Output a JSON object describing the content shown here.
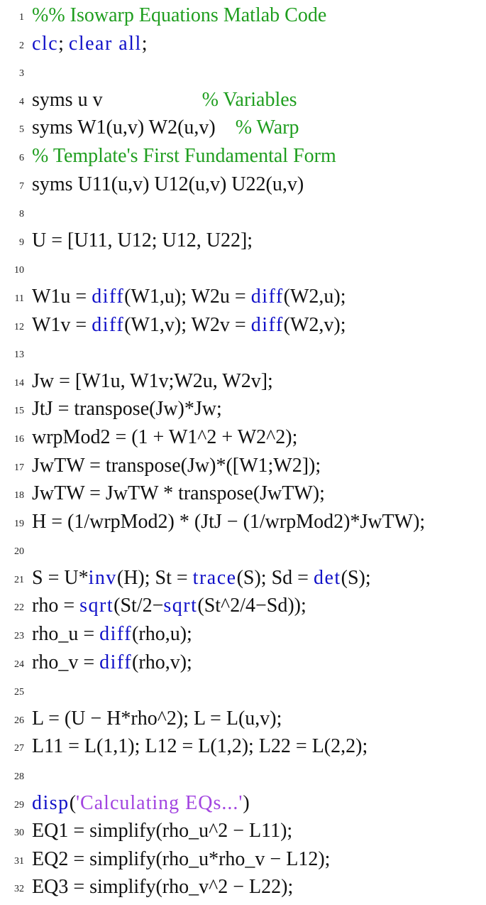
{
  "document": {
    "title": "Isowarp Equations Matlab Code",
    "language": "Matlab",
    "colors": {
      "text": "#111111",
      "keyword": "#1010c8",
      "comment": "#1f9e1f",
      "string": "#a244e0"
    },
    "lines": [
      {
        "n": "1",
        "tokens": [
          {
            "t": "cm",
            "v": "%% Isowarp Equations Matlab Code"
          }
        ]
      },
      {
        "n": "2",
        "tokens": [
          {
            "t": "kw",
            "v": "clc"
          },
          {
            "t": "nm",
            "v": "; "
          },
          {
            "t": "kw",
            "v": "clear all"
          },
          {
            "t": "nm",
            "v": ";"
          }
        ]
      },
      {
        "n": "3",
        "tokens": []
      },
      {
        "n": "4",
        "tokens": [
          {
            "t": "nm",
            "v": "syms u v                    "
          },
          {
            "t": "cm",
            "v": "% Variables"
          }
        ]
      },
      {
        "n": "5",
        "tokens": [
          {
            "t": "nm",
            "v": "syms W1(u,v) W2(u,v)    "
          },
          {
            "t": "cm",
            "v": "% Warp"
          }
        ]
      },
      {
        "n": "6",
        "tokens": [
          {
            "t": "cm",
            "v": "% Template's First Fundamental Form"
          }
        ]
      },
      {
        "n": "7",
        "tokens": [
          {
            "t": "nm",
            "v": "syms U11(u,v) U12(u,v) U22(u,v)"
          }
        ]
      },
      {
        "n": "8",
        "tokens": []
      },
      {
        "n": "9",
        "tokens": [
          {
            "t": "nm",
            "v": "U = [U11, U12; U12, U22];"
          }
        ]
      },
      {
        "n": "10",
        "tokens": []
      },
      {
        "n": "11",
        "tokens": [
          {
            "t": "nm",
            "v": "W1u = "
          },
          {
            "t": "kw",
            "v": "diff"
          },
          {
            "t": "nm",
            "v": "(W1,u); W2u = "
          },
          {
            "t": "kw",
            "v": "diff"
          },
          {
            "t": "nm",
            "v": "(W2,u);"
          }
        ]
      },
      {
        "n": "12",
        "tokens": [
          {
            "t": "nm",
            "v": "W1v = "
          },
          {
            "t": "kw",
            "v": "diff"
          },
          {
            "t": "nm",
            "v": "(W1,v); W2v = "
          },
          {
            "t": "kw",
            "v": "diff"
          },
          {
            "t": "nm",
            "v": "(W2,v);"
          }
        ]
      },
      {
        "n": "13",
        "tokens": []
      },
      {
        "n": "14",
        "tokens": [
          {
            "t": "nm",
            "v": "Jw = [W1u, W1v;W2u, W2v];"
          }
        ]
      },
      {
        "n": "15",
        "tokens": [
          {
            "t": "nm",
            "v": "JtJ = transpose(Jw)*Jw;"
          }
        ]
      },
      {
        "n": "16",
        "tokens": [
          {
            "t": "nm",
            "v": "wrpMod2 = (1 + W1^2 + W2^2);"
          }
        ]
      },
      {
        "n": "17",
        "tokens": [
          {
            "t": "nm",
            "v": "JwTW = transpose(Jw)*([W1;W2]);"
          }
        ]
      },
      {
        "n": "18",
        "tokens": [
          {
            "t": "nm",
            "v": "JwTW = JwTW * transpose(JwTW);"
          }
        ]
      },
      {
        "n": "19",
        "tokens": [
          {
            "t": "nm",
            "v": "H = (1/wrpMod2) * (JtJ − (1/wrpMod2)*JwTW);"
          }
        ]
      },
      {
        "n": "20",
        "tokens": []
      },
      {
        "n": "21",
        "tokens": [
          {
            "t": "nm",
            "v": "S = U*"
          },
          {
            "t": "kw",
            "v": "inv"
          },
          {
            "t": "nm",
            "v": "(H); St = "
          },
          {
            "t": "kw",
            "v": "trace"
          },
          {
            "t": "nm",
            "v": "(S); Sd = "
          },
          {
            "t": "kw",
            "v": "det"
          },
          {
            "t": "nm",
            "v": "(S);"
          }
        ]
      },
      {
        "n": "22",
        "tokens": [
          {
            "t": "nm",
            "v": "rho = "
          },
          {
            "t": "kw",
            "v": "sqrt"
          },
          {
            "t": "nm",
            "v": "(St/2−"
          },
          {
            "t": "kw",
            "v": "sqrt"
          },
          {
            "t": "nm",
            "v": "(St^2/4−Sd));"
          }
        ]
      },
      {
        "n": "23",
        "tokens": [
          {
            "t": "nm",
            "v": "rho_u = "
          },
          {
            "t": "kw",
            "v": "diff"
          },
          {
            "t": "nm",
            "v": "(rho,u);"
          }
        ]
      },
      {
        "n": "24",
        "tokens": [
          {
            "t": "nm",
            "v": "rho_v = "
          },
          {
            "t": "kw",
            "v": "diff"
          },
          {
            "t": "nm",
            "v": "(rho,v);"
          }
        ]
      },
      {
        "n": "25",
        "tokens": []
      },
      {
        "n": "26",
        "tokens": [
          {
            "t": "nm",
            "v": "L = (U − H*rho^2); L = L(u,v);"
          }
        ]
      },
      {
        "n": "27",
        "tokens": [
          {
            "t": "nm",
            "v": "L11 = L(1,1); L12 = L(1,2); L22 = L(2,2);"
          }
        ]
      },
      {
        "n": "28",
        "tokens": []
      },
      {
        "n": "29",
        "tokens": [
          {
            "t": "kw",
            "v": "disp"
          },
          {
            "t": "nm",
            "v": "("
          },
          {
            "t": "str",
            "v": "'Calculating EQs...'"
          },
          {
            "t": "nm",
            "v": ")"
          }
        ]
      },
      {
        "n": "30",
        "tokens": [
          {
            "t": "nm",
            "v": "EQ1 = simplify(rho_u^2 − L11);"
          }
        ]
      },
      {
        "n": "31",
        "tokens": [
          {
            "t": "nm",
            "v": "EQ2 = simplify(rho_u*rho_v − L12);"
          }
        ]
      },
      {
        "n": "32",
        "tokens": [
          {
            "t": "nm",
            "v": "EQ3 = simplify(rho_v^2 − L22);"
          }
        ]
      }
    ]
  }
}
